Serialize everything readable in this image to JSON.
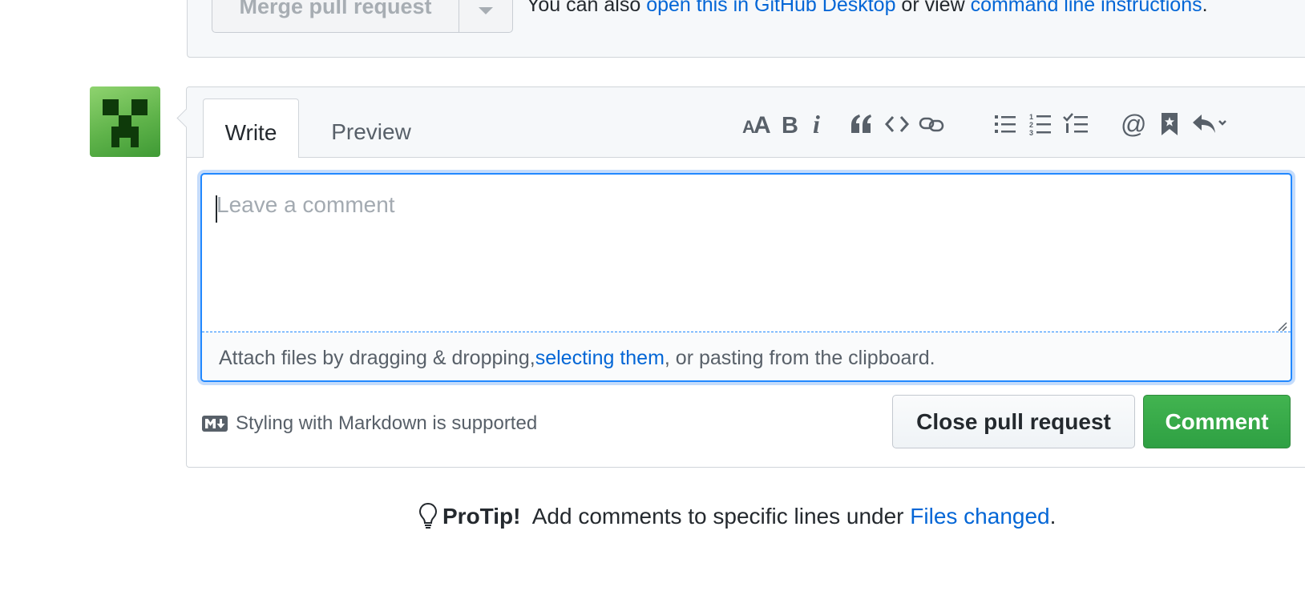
{
  "merge": {
    "button_label": "Merge pull request",
    "also_prefix": "You can also ",
    "desktop_link": "open this in GitHub Desktop",
    "or_view": " or view ",
    "cli_link": "command line instructions",
    "period": "."
  },
  "comment_form": {
    "tabs": [
      {
        "label": "Write",
        "selected": true
      },
      {
        "label": "Preview",
        "selected": false
      }
    ],
    "toolbar_icons": [
      "text-size-icon",
      "bold-icon",
      "italic-icon",
      "quote-icon",
      "code-icon",
      "link-icon",
      "bulleted-list-icon",
      "numbered-list-icon",
      "task-list-icon",
      "mention-icon",
      "reference-icon",
      "reply-icon"
    ],
    "textarea_placeholder": "Leave a comment",
    "textarea_value": "",
    "attach_prefix": "Attach files by dragging & dropping, ",
    "attach_link": "selecting them",
    "attach_suffix": ", or pasting from the clipboard.",
    "markdown_note": "Styling with Markdown is supported",
    "close_button": "Close pull request",
    "comment_button": "Comment"
  },
  "protip": {
    "label": "ProTip!",
    "text": " Add comments to specific lines under ",
    "link": "Files changed",
    "period": "."
  },
  "colors": {
    "link": "#0366d6",
    "comment_button": "#2ea043",
    "focus_border": "#2188ff"
  }
}
